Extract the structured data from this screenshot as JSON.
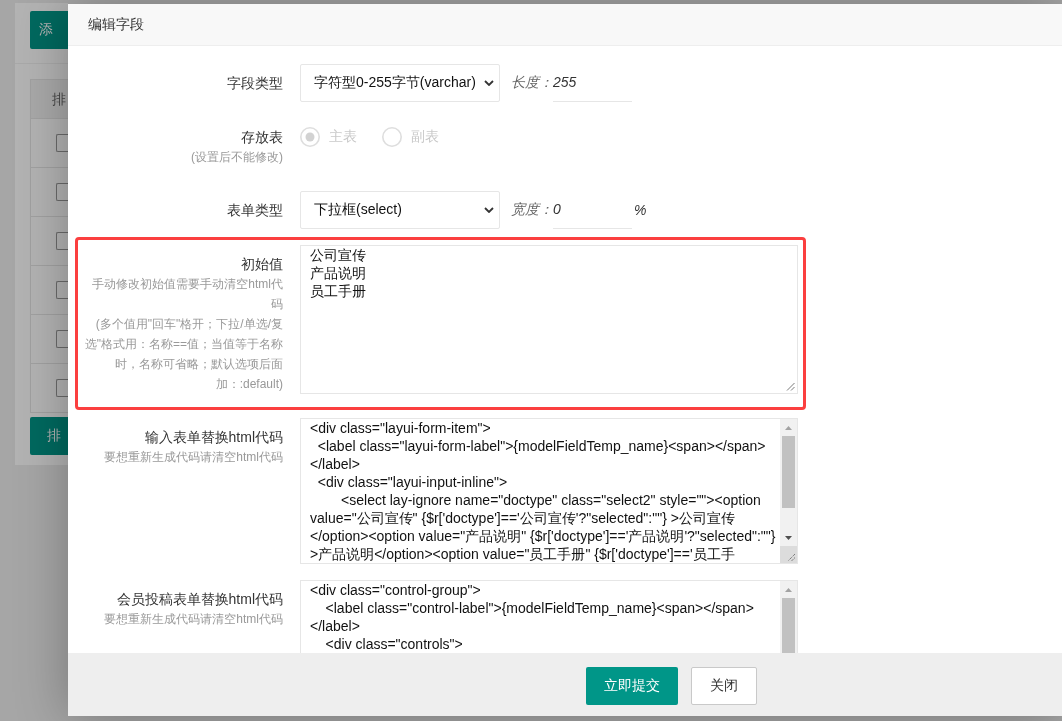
{
  "background_page": {
    "add_button": "添",
    "table": {
      "header": "排",
      "rows": [
        {
          "checked": false
        },
        {
          "checked": false
        },
        {
          "checked": false
        },
        {
          "checked": false
        },
        {
          "checked": false
        },
        {
          "checked": false
        }
      ]
    },
    "sort_button": "排"
  },
  "dialog": {
    "title": "编辑字段",
    "fields": [
      {
        "kind": "select",
        "label": "字段类型",
        "highlighted": false,
        "value": "字符型0-255字节(varchar)",
        "inline_input": {
          "label": "长度：",
          "value": "255"
        }
      },
      {
        "kind": "radio",
        "label": "存放表",
        "help": [
          "(设置后不能修改)"
        ],
        "highlighted": false,
        "disabled": true,
        "options": [
          {
            "label": "主表",
            "selected": true
          },
          {
            "label": "副表",
            "selected": false
          }
        ]
      },
      {
        "kind": "select",
        "label": "表单类型",
        "highlighted": false,
        "value": "下拉框(select)",
        "inline_input": {
          "label": "宽度：",
          "value": "0",
          "unit": "%"
        }
      },
      {
        "kind": "textarea",
        "label": "初始值",
        "help": [
          "手动修改初始值需要手动清空html代",
          "码",
          "(多个值用\"回车\"格开；下拉/单选/复",
          "选\"格式用：名称==值；当值等于名称",
          "时，名称可省略；默认选项后面",
          "加：:default)"
        ],
        "highlighted": true,
        "lines": [
          "公司宣传",
          "产品说明",
          "员工手册"
        ]
      },
      {
        "kind": "code",
        "label": "输入表单替换html代码",
        "help": [
          "要想重新生成代码请清空html代码"
        ],
        "highlighted": false,
        "lines": [
          "<div class=\"layui-form-item\">",
          "  <label class=\"layui-form-label\">{modelFieldTemp_name}<span></span>",
          "</label>",
          "  <div class=\"layui-input-inline\">",
          "        <select lay-ignore name=\"doctype\" class=\"select2\" style=\"\"><option",
          "value=\"公司宣传\" {$r['doctype']=='公司宣传'?\"selected\":\"\"} >公司宣传",
          "</option><option value=\"产品说明\" {$r['doctype']=='产品说明'?\"selected\":\"\"}",
          ">产品说明</option><option value=\"员工手册\" {$r['doctype']=='员工手"
        ]
      },
      {
        "kind": "code",
        "label": "会员投稿表单替换html代码",
        "help": [
          "要想重新生成代码请清空html代码"
        ],
        "highlighted": false,
        "lines": [
          "<div class=\"control-group\">",
          "    <label class=\"control-label\">{modelFieldTemp_name}<span></span>",
          "</label>",
          "    <div class=\"controls\">"
        ]
      }
    ],
    "buttons": [
      {
        "label": "立即提交",
        "kind": "primary"
      },
      {
        "label": "关闭",
        "kind": "default"
      }
    ]
  }
}
